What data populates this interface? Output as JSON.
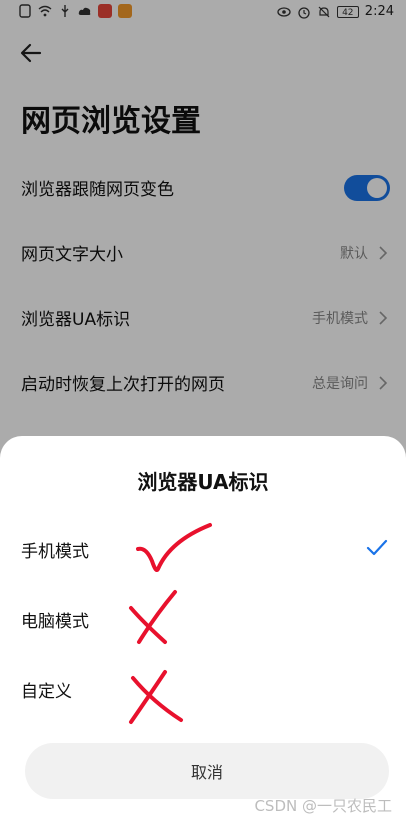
{
  "status_bar": {
    "time": "2:24",
    "battery": "42"
  },
  "header": {
    "title": "网页浏览设置"
  },
  "settings": [
    {
      "label": "浏览器跟随网页变色",
      "type": "toggle",
      "on": true
    },
    {
      "label": "网页文字大小",
      "value": "默认"
    },
    {
      "label": "浏览器UA标识",
      "value": "手机模式"
    },
    {
      "label": "启动时恢复上次打开的网页",
      "value": "总是询问"
    }
  ],
  "sheet": {
    "title": "浏览器UA标识",
    "options": [
      {
        "label": "手机模式",
        "selected": true
      },
      {
        "label": "电脑模式",
        "selected": false
      },
      {
        "label": "自定义",
        "selected": false
      }
    ],
    "cancel_label": "取消"
  },
  "watermark": "CSDN @一只农民工",
  "colors": {
    "accent": "#1a73e8",
    "annotation": "#e8112d"
  }
}
